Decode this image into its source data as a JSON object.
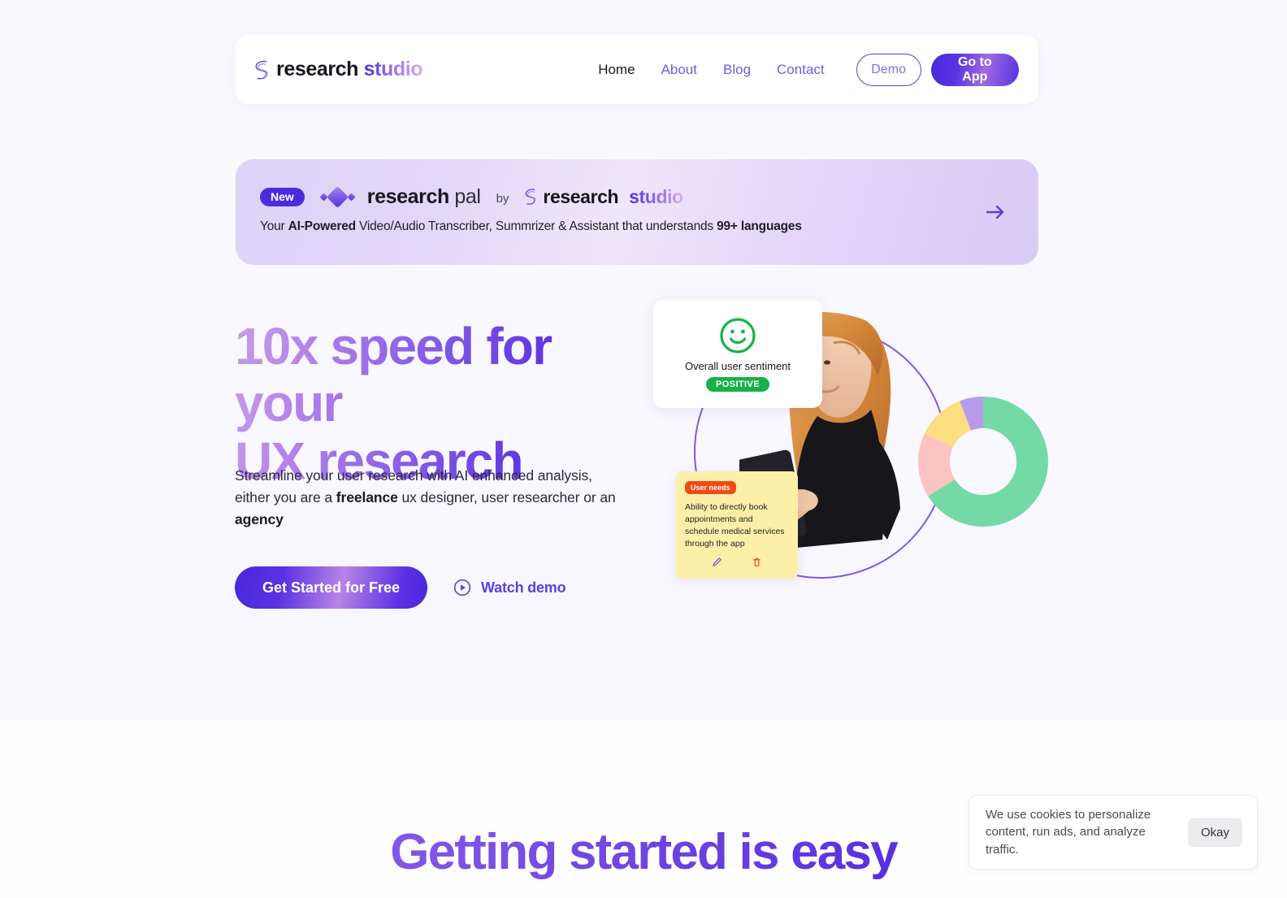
{
  "header": {
    "brand": {
      "word1": "research",
      "word2": "studio",
      "icon": "ribbon-s-logo-icon"
    },
    "nav": [
      {
        "label": "Home",
        "active": true
      },
      {
        "label": "About",
        "active": false
      },
      {
        "label": "Blog",
        "active": false
      },
      {
        "label": "Contact",
        "active": false
      }
    ],
    "demo_label": "Demo",
    "app_label": "Go to App"
  },
  "banner": {
    "badge": "New",
    "product_bold": "research",
    "product_light": "pal",
    "by": "by",
    "brand_word1": "research",
    "brand_word2": "studio",
    "sub_a": "Your ",
    "sub_b": "AI-Powered",
    "sub_c": " Video/Audio Transcriber, Summrizer & Assistant that understands ",
    "sub_d": "99+ languages",
    "arrow_icon": "arrow-right-icon"
  },
  "hero": {
    "title_line1": "10x speed for your",
    "title_line2": "UX research",
    "sub_a": "Streamline your user research with AI enhanced analysis, either you are a ",
    "sub_b": "freelance",
    "sub_c": " ux designer, user researcher or an ",
    "sub_d": "agency",
    "cta_primary": "Get Started for Free",
    "cta_secondary": "Watch demo",
    "play_icon": "play-circle-icon"
  },
  "illustration": {
    "sentiment_card": {
      "face_icon": "smiley-face-icon",
      "label": "Overall user sentiment",
      "badge": "POSITIVE",
      "badge_color": "#18b04a"
    },
    "note_card": {
      "tag": "User needs",
      "tag_color": "#f24a14",
      "text": "Ability to directly book appointments and schedule medical services through the app",
      "edit_icon": "pencil-icon",
      "delete_icon": "trash-icon"
    },
    "person_alt": "woman-with-tablet-photo",
    "circle": "decorative-purple-circle"
  },
  "chart_data": {
    "type": "pie",
    "title": "",
    "categories": [
      "Green",
      "Pink",
      "Yellow",
      "Purple"
    ],
    "values": [
      66,
      16,
      12,
      6
    ],
    "colors": [
      "#74d9a4",
      "#fcc3c1",
      "#fade7f",
      "#b79aec"
    ],
    "donut": true,
    "legend": "none"
  },
  "section2": {
    "title": "Getting started is easy"
  },
  "cookie": {
    "text": "We use cookies to personalize content, run ads, and analyze traffic.",
    "accept_label": "Okay"
  }
}
